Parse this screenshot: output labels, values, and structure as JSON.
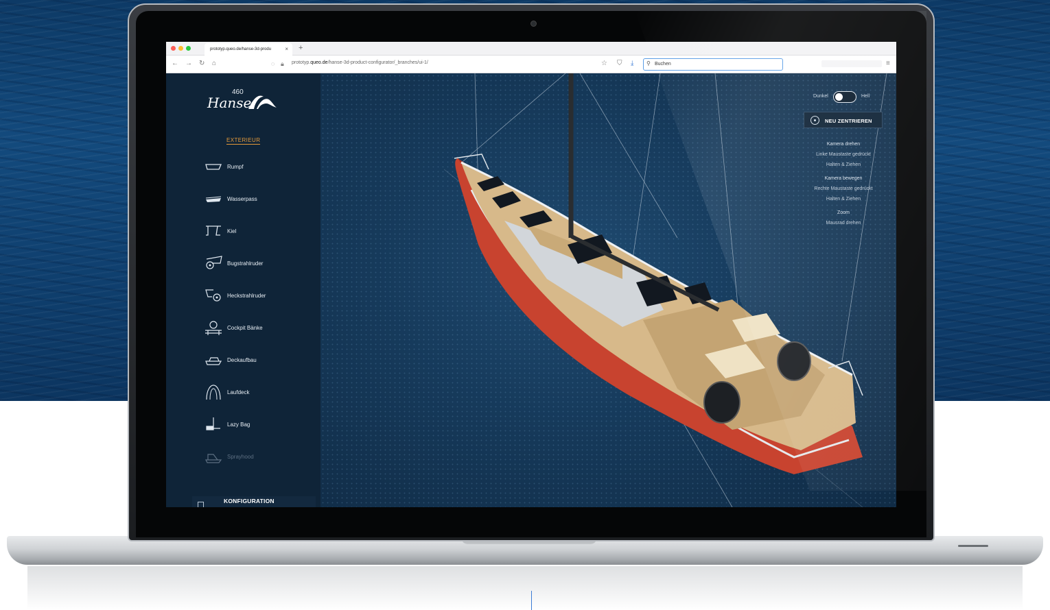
{
  "browser": {
    "tab_title": "prototyp.queo.de/hanse-3d-produ",
    "tab_close": "×",
    "new_tab": "+",
    "url_prefix": "prototyp.",
    "url_domain": "queo.de",
    "url_path": "/hanse-3d-product-configurator/_branches/ui-1/",
    "search_value": "Buchen",
    "traffic_colors": [
      "#fd5f57",
      "#febc2e",
      "#28c840"
    ]
  },
  "app": {
    "logo_model": "460",
    "logo_word": "Hanse",
    "section_title": "EXTERIEUR",
    "menu": [
      {
        "label": "Rumpf",
        "icon": "hull-icon"
      },
      {
        "label": "Wasserpass",
        "icon": "waterline-icon"
      },
      {
        "label": "Kiel",
        "icon": "keel-icon"
      },
      {
        "label": "Bugstrahlruder",
        "icon": "bow-thruster-icon"
      },
      {
        "label": "Heckstrahlruder",
        "icon": "stern-thruster-icon"
      },
      {
        "label": "Cockpit Bänke",
        "icon": "cockpit-bench-icon"
      },
      {
        "label": "Deckaufbau",
        "icon": "deckhouse-icon"
      },
      {
        "label": "Laufdeck",
        "icon": "deck-icon"
      },
      {
        "label": "Lazy Bag",
        "icon": "lazy-bag-icon"
      },
      {
        "label": "Sprayhood",
        "icon": "sprayhood-icon"
      }
    ],
    "konfiguration_label": "KONFIGURATION",
    "toggle_left": "Dunkel",
    "toggle_right": "Hell",
    "recenter_label": "NEU ZENTRIEREN",
    "help": {
      "rotate_title": "Kamera drehen",
      "rotate_line1": "Linke Maustaste gedrückt",
      "rotate_line2": "Halten & Ziehen",
      "move_title": "Kamera bewegen",
      "move_line1": "Rechte Maustaste gedrückt",
      "move_line2": "Halten & Ziehen",
      "zoom_title": "Zoom",
      "zoom_line1": "Mausrad drehen"
    },
    "colors": {
      "accent": "#e59a3a",
      "sidebar": "#0f2438",
      "hull_red": "#c8432f"
    }
  }
}
